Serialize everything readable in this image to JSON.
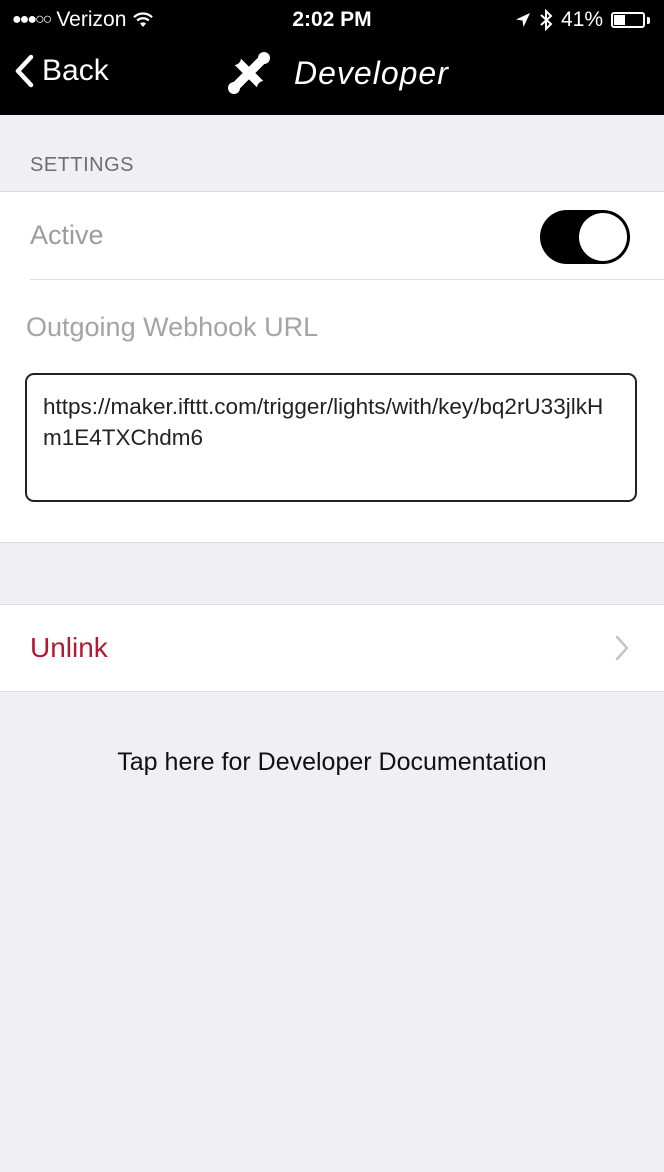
{
  "status_bar": {
    "carrier": "Verizon",
    "time": "2:02 PM",
    "battery": "41%",
    "battery_level": 0.41
  },
  "nav": {
    "back_label": "Back",
    "title": "Developer",
    "title_icon": "tools-icon"
  },
  "settings": {
    "section_header": "SETTINGS",
    "active_label": "Active",
    "active_on": true,
    "webhook_label": "Outgoing Webhook URL",
    "webhook_value": "https://maker.ifttt.com/trigger/lights/with/key/bq2rU33jlkHm1E4TXChdm6"
  },
  "unlink": {
    "label": "Unlink"
  },
  "docs": {
    "link_text": "Tap here for Developer Documentation"
  },
  "colors": {
    "nav_background": "#000000",
    "page_background": "#efeff4",
    "unlink_red": "#b3192f",
    "toggle_on": "#000000"
  }
}
